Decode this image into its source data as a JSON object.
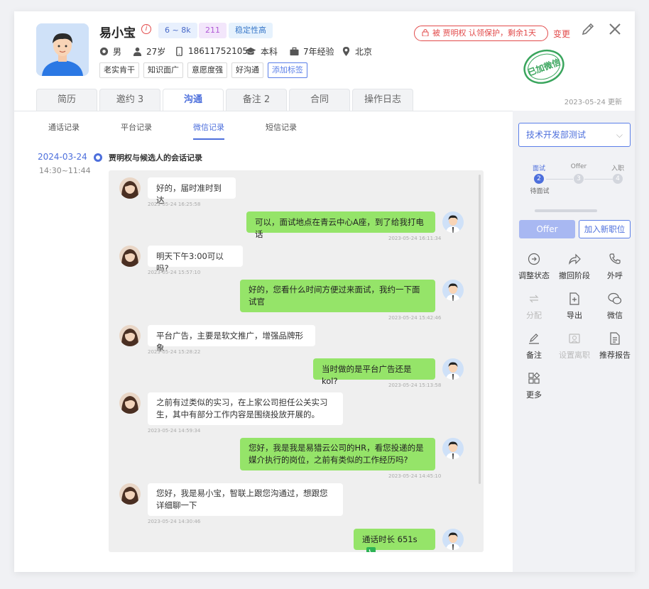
{
  "candidate": {
    "name": "易小宝",
    "salary": "6 ~ 8k",
    "school_tag": "211",
    "stable_tag": "稳定性高",
    "gender": "男",
    "age": "27岁",
    "phone": "18611752105",
    "education": "本科",
    "experience": "7年经验",
    "city": "北京"
  },
  "traits": [
    "老实肯干",
    "知识面广",
    "意愿度强",
    "好沟通"
  ],
  "add_tag": "添加标签",
  "protect": "被 贾明权 认领保护，剩余1天",
  "change": "变更",
  "stamp": "已加微信",
  "updated": "2023-05-24 更新",
  "tabs": [
    {
      "label": "简历"
    },
    {
      "label": "邀约 3"
    },
    {
      "label": "沟通"
    },
    {
      "label": "备注 2"
    },
    {
      "label": "合同"
    },
    {
      "label": "操作日志"
    }
  ],
  "subtabs": [
    {
      "label": "通话记录"
    },
    {
      "label": "平台记录"
    },
    {
      "label": "微信记录"
    },
    {
      "label": "短信记录"
    }
  ],
  "conversation": {
    "date": "2024-03-24",
    "time": "14:30~11:44",
    "title": "贾明权与候选人的会话记录"
  },
  "messages": [
    {
      "side": "l",
      "text": "好的，届时准时到达",
      "ts": "2023-05-24 16:25:58"
    },
    {
      "side": "r",
      "text": "可以，面试地点在青云中心A座，到了给我打电话",
      "ts": "2023-05-24 16:11:34"
    },
    {
      "side": "l",
      "text": "明天下午3:00可以吗?",
      "ts": "2023-05-24 15:57:10"
    },
    {
      "side": "r",
      "text": "好的，您看什么时间方便过来面试，我约一下面试官",
      "ts": "2023-05-24 15:42:46"
    },
    {
      "side": "l",
      "text": "平台广告，主要是软文推广，增强品牌形象",
      "ts": "2023-05-24 15:28:22"
    },
    {
      "side": "r",
      "text": "当时做的是平台广告还是kol?",
      "ts": "2023-05-24 15:13:58"
    },
    {
      "side": "l",
      "text": "之前有过类似的实习，在上家公司担任公关实习生，其中有部分工作内容是围绕投放开展的。",
      "ts": "2023-05-24 14:59:34"
    },
    {
      "side": "r",
      "text": "您好，我是我是易猎云公司的HR，看您投递的是媒介执行的岗位，之前有类似的工作经历吗?",
      "ts": "2023-05-24 14:45:10"
    },
    {
      "side": "l",
      "text": "您好，我是易小宝，智联上跟您沟通过，想跟您详细聊一下",
      "ts": "2023-05-24 14:30:46"
    },
    {
      "side": "r",
      "text": "通话时长 651s",
      "ts": ""
    }
  ],
  "sidebar": {
    "position": "技术开发部测试",
    "steps": [
      {
        "label": "面试",
        "num": "2"
      },
      {
        "label": "Offer",
        "num": "3"
      },
      {
        "label": "入职",
        "num": "4"
      }
    ],
    "step_status": "待面试",
    "offer_btn": "Offer",
    "add_btn": "加入新职位",
    "actions": [
      {
        "label": "调整状态"
      },
      {
        "label": "撤回阶段"
      },
      {
        "label": "外呼"
      },
      {
        "label": "分配"
      },
      {
        "label": "导出"
      },
      {
        "label": "微信"
      },
      {
        "label": "备注"
      },
      {
        "label": "设置离职"
      },
      {
        "label": "推荐报告"
      },
      {
        "label": "更多"
      }
    ]
  },
  "colors": {
    "accent": "#4d6fdc",
    "danger": "#e24b4b",
    "bubble_right": "#95e469",
    "stamp": "#3aa55d"
  }
}
